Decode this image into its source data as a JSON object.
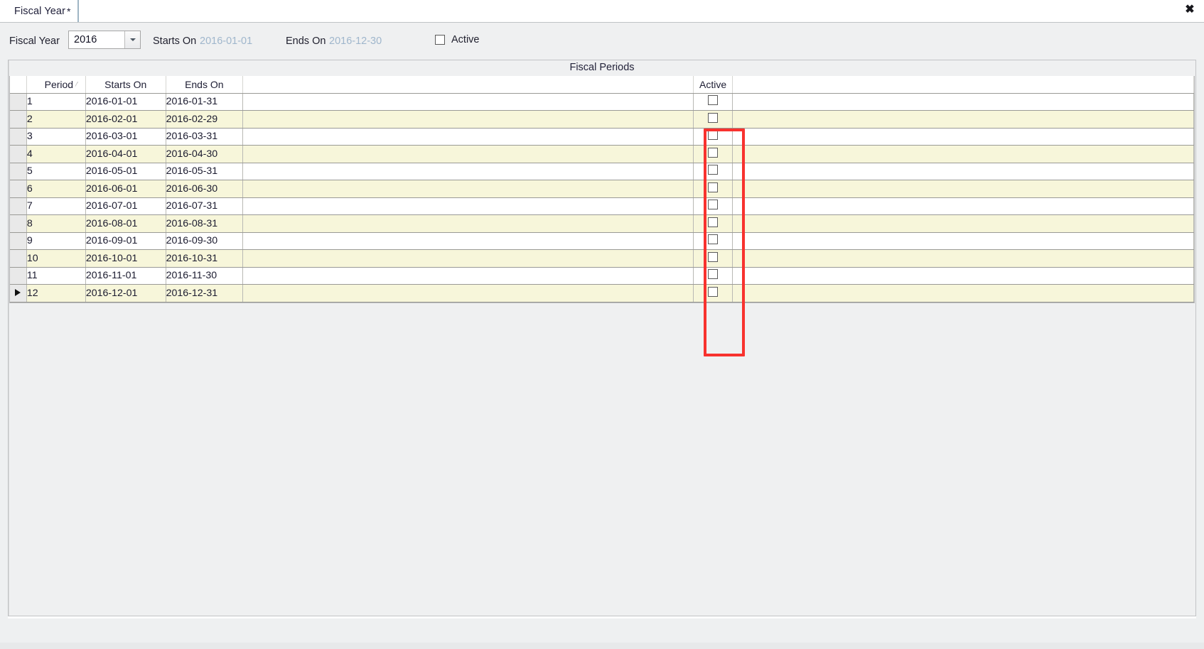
{
  "window": {
    "close_label": "✖"
  },
  "tab": {
    "label": "Fiscal Year",
    "dirty_marker": "*"
  },
  "header": {
    "fiscal_year_label": "Fiscal Year",
    "fiscal_year_value": "2016",
    "fiscal_year_options": [
      "2016"
    ],
    "starts_on_label": "Starts On",
    "starts_on_value": "2016-01-01",
    "ends_on_label": "Ends On",
    "ends_on_value": "2016-12-30",
    "active_label": "Active",
    "active_checked": false
  },
  "grid": {
    "caption": "Fiscal Periods",
    "sort_column": "Period",
    "sort_direction": "ascending",
    "selected_row_index": 11,
    "columns": [
      {
        "key": "rowmark",
        "label": ""
      },
      {
        "key": "period",
        "label": "Period"
      },
      {
        "key": "starts_on",
        "label": "Starts On"
      },
      {
        "key": "ends_on",
        "label": "Ends On"
      },
      {
        "key": "spacer",
        "label": ""
      },
      {
        "key": "active",
        "label": "Active"
      },
      {
        "key": "fill",
        "label": ""
      }
    ],
    "rows": [
      {
        "period": "1",
        "starts_on": "2016-01-01",
        "ends_on": "2016-01-31",
        "active": false
      },
      {
        "period": "2",
        "starts_on": "2016-02-01",
        "ends_on": "2016-02-29",
        "active": false
      },
      {
        "period": "3",
        "starts_on": "2016-03-01",
        "ends_on": "2016-03-31",
        "active": false
      },
      {
        "period": "4",
        "starts_on": "2016-04-01",
        "ends_on": "2016-04-30",
        "active": false
      },
      {
        "period": "5",
        "starts_on": "2016-05-01",
        "ends_on": "2016-05-31",
        "active": false
      },
      {
        "period": "6",
        "starts_on": "2016-06-01",
        "ends_on": "2016-06-30",
        "active": false
      },
      {
        "period": "7",
        "starts_on": "2016-07-01",
        "ends_on": "2016-07-31",
        "active": false
      },
      {
        "period": "8",
        "starts_on": "2016-08-01",
        "ends_on": "2016-08-31",
        "active": false
      },
      {
        "period": "9",
        "starts_on": "2016-09-01",
        "ends_on": "2016-09-30",
        "active": false
      },
      {
        "period": "10",
        "starts_on": "2016-10-01",
        "ends_on": "2016-10-31",
        "active": false
      },
      {
        "period": "11",
        "starts_on": "2016-11-01",
        "ends_on": "2016-11-30",
        "active": false
      },
      {
        "period": "12",
        "starts_on": "2016-12-01",
        "ends_on": "2016-12-31",
        "active": false
      }
    ]
  },
  "annotation": {
    "highlight_target": "active-column",
    "color": "#f8322e"
  },
  "colors": {
    "row_alt_background": "#f7f6da",
    "row_background": "#ffffff",
    "muted_value": "#9fb6cc",
    "panel_background": "#eff0f1"
  }
}
